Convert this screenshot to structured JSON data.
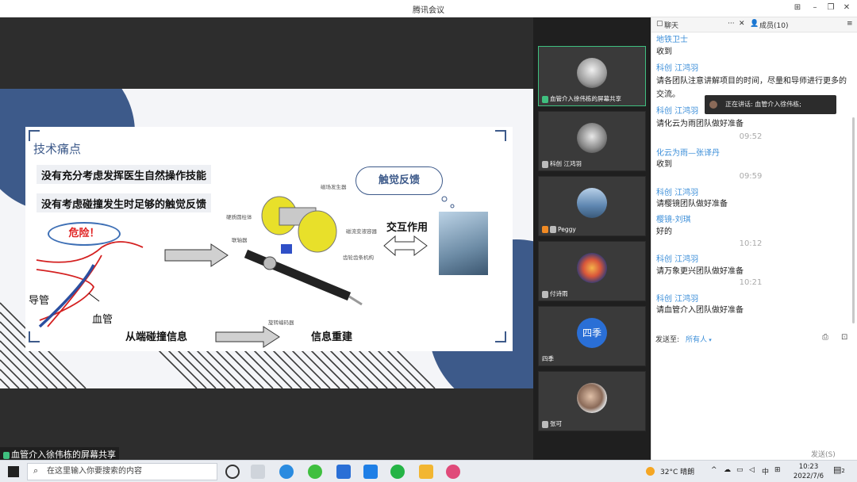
{
  "window": {
    "title": "腾讯会议"
  },
  "slide": {
    "title": "技术痛点",
    "issues": [
      "没有充分考虑发挥医生自然操作技能",
      "没有考虑碰撞发生时足够的触觉反馈"
    ],
    "cloud": "触觉反馈",
    "danger": "危险！",
    "labels": {
      "catheter": "导管",
      "vessel": "血管",
      "interaction": "交互作用",
      "collision_info": "从端碰撞信息",
      "info_rebuild": "信息重建"
    },
    "device_labels": {
      "magnet": "磁场发生器",
      "cylinder": "硬质圆柱体",
      "coupler": "联轴器",
      "mr_fluid": "磁流变液容器",
      "gear": "齿轮齿条机构",
      "encoder": "旋转编码器"
    }
  },
  "share_label": "血管介入徐伟栋的屏幕共享",
  "participants": [
    {
      "name": "血管介入徐伟栋的屏幕共享",
      "active": true,
      "avatar": "sketch-avatar"
    },
    {
      "name": "科创 江鸿羽",
      "active": false,
      "avatar": "anime-avatar"
    },
    {
      "name": "Peggy",
      "active": false,
      "avatar": "sky-avatar"
    },
    {
      "name": "付诗雨",
      "active": false,
      "avatar": "fire-avatar"
    },
    {
      "name": "四季",
      "active": false,
      "avatar": "text-avatar",
      "initials": "四季"
    },
    {
      "name": "张可",
      "active": false,
      "avatar": "person-avatar"
    }
  ],
  "chat": {
    "tab_chat": "聊天",
    "tab_members": "成员(10)",
    "messages": [
      {
        "sender": "地铁卫士",
        "text": "收到"
      },
      {
        "sender": "科创 江鸿羽",
        "text": "请各团队注意讲解项目的时间，尽量和导师进行更多的交流。"
      },
      {
        "sender": "科创 江鸿羽",
        "text": "请化云为雨团队做好准备"
      },
      {
        "time": "09:52"
      },
      {
        "sender": "化云为雨—张译丹",
        "text": "收到"
      },
      {
        "time": "09:59"
      },
      {
        "sender": "科创 江鸿羽",
        "text": "请樱镜团队做好准备"
      },
      {
        "sender": "樱镜-刘琪",
        "text": "好的"
      },
      {
        "time": "10:12"
      },
      {
        "sender": "科创 江鸿羽",
        "text": "请万象更兴团队做好准备"
      },
      {
        "time": "10:21"
      },
      {
        "sender": "科创 江鸿羽",
        "text": "请血管介入团队做好准备"
      }
    ],
    "speaking_tooltip": "正在讲话: 血管介入徐伟栋;",
    "send_to_label": "发送至:",
    "send_to_value": "所有人",
    "send_button": "发送(S)"
  },
  "taskbar": {
    "search_placeholder": "在这里输入你要搜索的内容",
    "weather": "32°C 晴朗",
    "ime": "中",
    "time": "10:23",
    "date": "2022/7/6",
    "notifications": "2"
  },
  "colors": {
    "accent": "#3d5a8a",
    "chat_sender": "#3d8fd9",
    "active_tile": "#3fbf7f",
    "danger": "#e02020"
  }
}
